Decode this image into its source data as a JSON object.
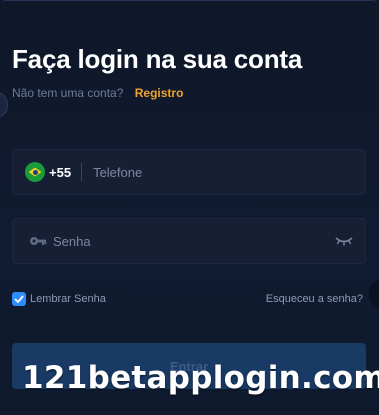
{
  "header": {
    "title": "Faça login na sua conta",
    "signup_prompt": "Não tem uma conta?",
    "signup_link": "Registro"
  },
  "phone_field": {
    "country_flag_icon": "brazil-flag-icon",
    "country_code": "+55",
    "placeholder": "Telefone",
    "value": ""
  },
  "password_field": {
    "leading_icon": "key-icon",
    "placeholder": "Senha",
    "value": "",
    "toggle_icon": "eye-closed-icon"
  },
  "remember": {
    "label": "Lembrar Senha",
    "checked": true
  },
  "forgot_link": "Esqueceu a senha?",
  "submit_label": "Entrar",
  "watermark": "121betapplogin.com",
  "colors": {
    "background": "#0f1729",
    "field_background": "#161f34",
    "accent_link": "#f0a22a",
    "checkbox": "#2f8cff",
    "submit_background": "#1a3a66"
  }
}
